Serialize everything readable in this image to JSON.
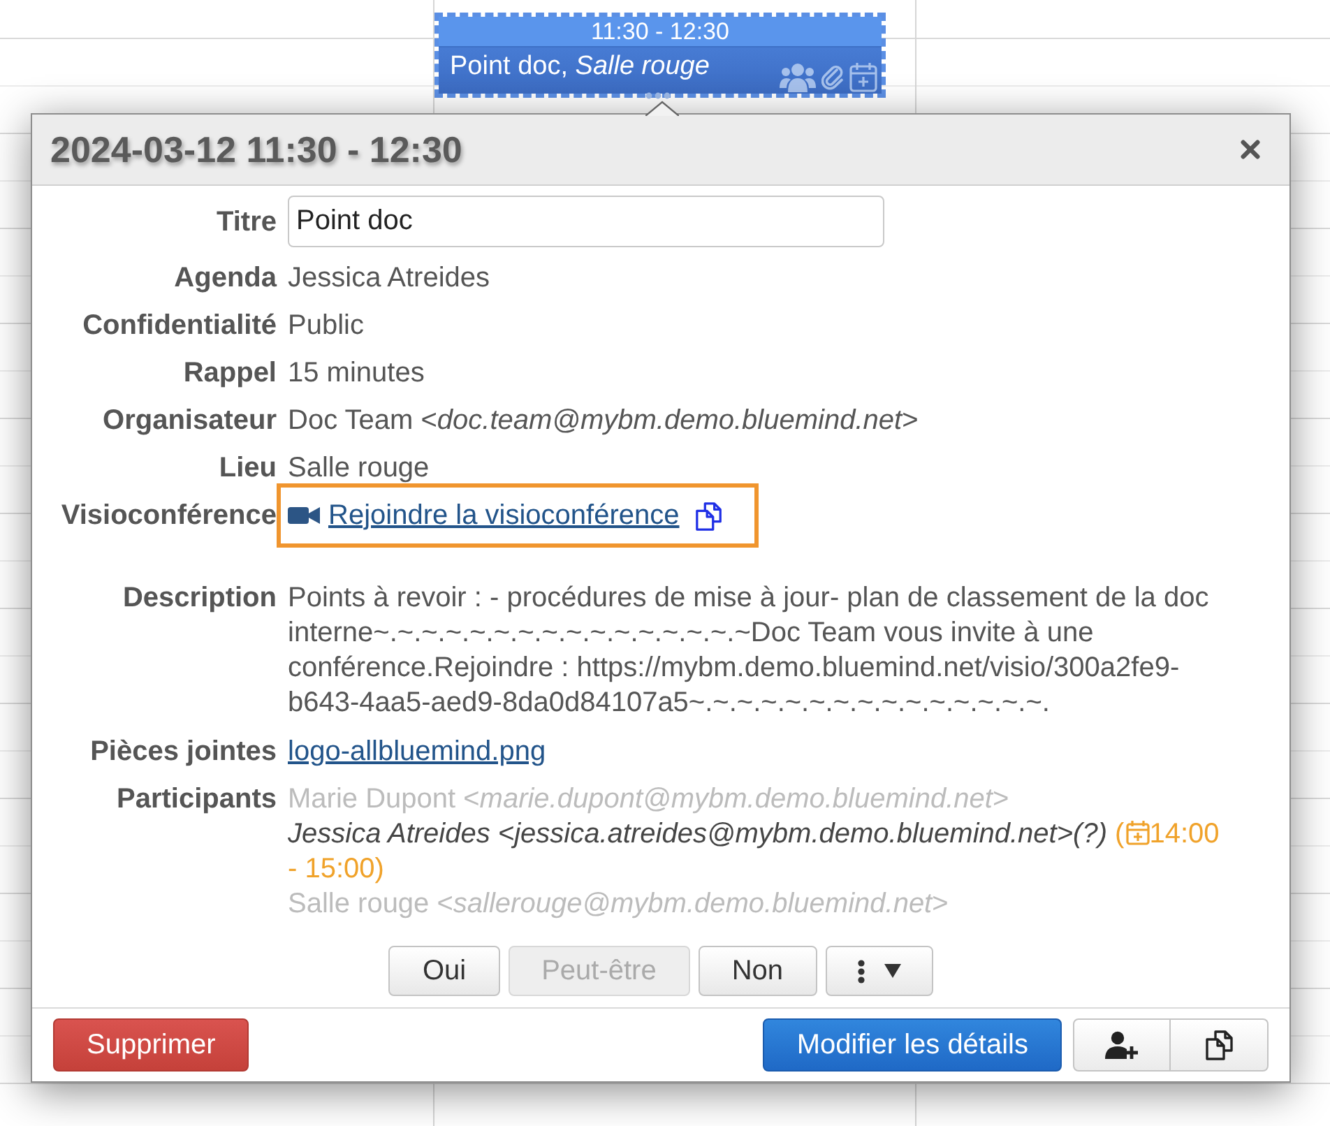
{
  "calendar_event": {
    "time": "11:30 - 12:30",
    "summary": "Point doc, *Salle rouge*",
    "indicators": [
      {
        "kind": "attendees"
      },
      {
        "kind": "attachment"
      },
      {
        "kind": "invitation"
      }
    ]
  },
  "dialog": {
    "title": "2024-03-12 11:30 - 12:30",
    "fields": [
      {
        "kind": "input",
        "label": "Titre",
        "value": "Point doc"
      },
      {
        "kind": "text",
        "label": "Agenda",
        "value": "Jessica Atreides"
      },
      {
        "kind": "text",
        "label": "Confidentialité",
        "value": "Public"
      },
      {
        "kind": "text",
        "label": "Rappel",
        "value": "15 minutes"
      },
      {
        "kind": "text",
        "label": "Organisateur",
        "value": "Doc Team <*doc.team@mybm.demo.bluemind.net*>"
      },
      {
        "kind": "text",
        "label": "Lieu",
        "value": "Salle rouge"
      },
      {
        "kind": "video",
        "label": "Visioconférence",
        "link": "Rejoindre la visioconférence",
        "highlighted": true
      },
      {
        "kind": "paragraph",
        "label": "Description",
        "value": "Points à revoir : - procédures de mise à jour- plan de classement de la doc interne~.~.~.~.~.~.~.~.~.~.~.~.~.~.~.~Doc Team vous invite à une conférence.Rejoindre : https://mybm.demo.bluemind.net/visio/300a2fe9-b643-4aa5-aed9-8da0d84107a5~.~.~.~.~.~.~.~.~.~.~.~.~.~.~."
      },
      {
        "kind": "attachment",
        "label": "Pièces jointes",
        "link": "logo-allbluemind.png"
      },
      {
        "kind": "participants",
        "label": "Participants",
        "participants": [
          {
            "name": "Marie Dupont <*marie.dupont@mybm.demo.bluemind.net*>",
            "muted": true
          },
          {
            "name": "Jessica Atreides <jessica.atreides@mybm.demo.bluemind.net>(?)",
            "muted": false,
            "conflict": {
              "open": "(",
              "start": "14:00",
              "end": "- 15:00)"
            }
          },
          {
            "name": "Salle rouge <*sallerouge@mybm.demo.bluemind.net*>",
            "muted": true
          }
        ]
      }
    ],
    "response_buttons": [
      {
        "kind": "label",
        "label": "Oui",
        "disabled": false
      },
      {
        "kind": "label",
        "label": "Peut-être",
        "disabled": true
      },
      {
        "kind": "label",
        "label": "Non",
        "disabled": false
      },
      {
        "kind": "menu",
        "disabled": false
      }
    ],
    "footer": {
      "delete_button": "Supprimer",
      "edit_button": "Modifier les détails",
      "tool_buttons": [
        {
          "kind": "add-attendee"
        },
        {
          "kind": "duplicate"
        }
      ]
    }
  }
}
